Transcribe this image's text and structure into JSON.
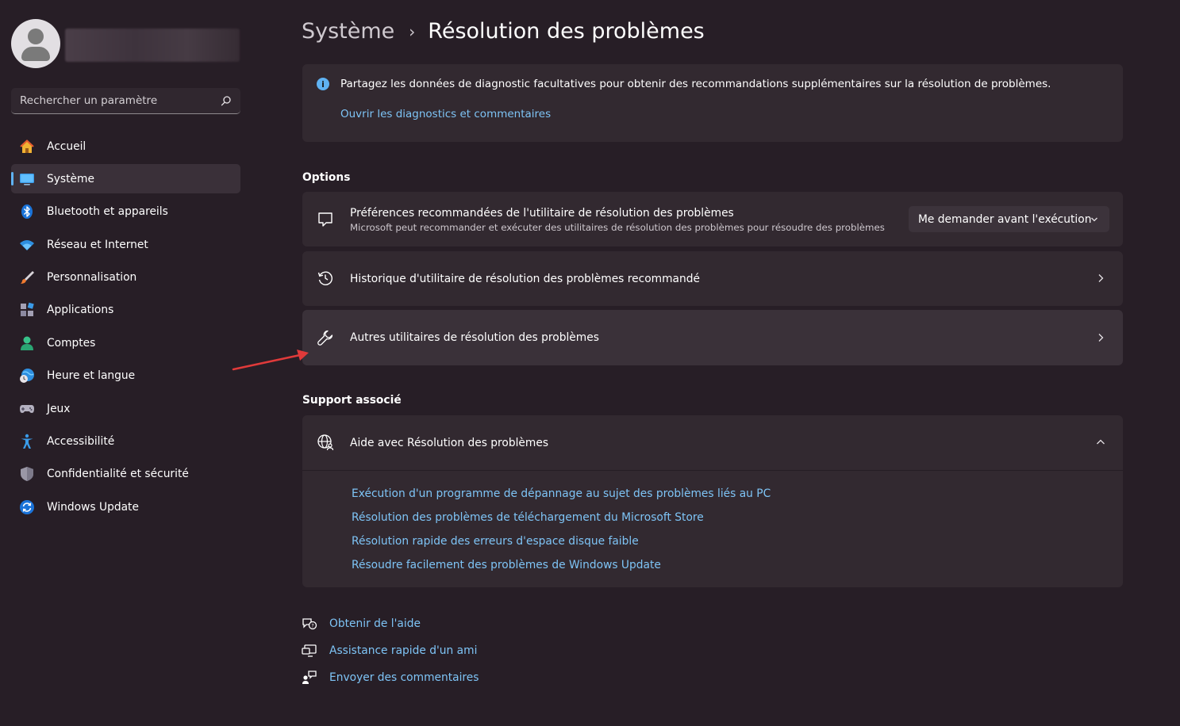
{
  "sidebar": {
    "search_placeholder": "Rechercher un paramètre",
    "items": [
      {
        "label": "Accueil",
        "icon": "home-icon"
      },
      {
        "label": "Système",
        "icon": "monitor-icon",
        "active": true
      },
      {
        "label": "Bluetooth et appareils",
        "icon": "bluetooth-icon"
      },
      {
        "label": "Réseau et Internet",
        "icon": "wifi-icon"
      },
      {
        "label": "Personnalisation",
        "icon": "brush-icon"
      },
      {
        "label": "Applications",
        "icon": "apps-icon"
      },
      {
        "label": "Comptes",
        "icon": "person-icon"
      },
      {
        "label": "Heure et langue",
        "icon": "globe-clock-icon"
      },
      {
        "label": "Jeux",
        "icon": "gamepad-icon"
      },
      {
        "label": "Accessibilité",
        "icon": "accessibility-icon"
      },
      {
        "label": "Confidentialité et sécurité",
        "icon": "shield-icon"
      },
      {
        "label": "Windows Update",
        "icon": "update-icon"
      }
    ]
  },
  "header": {
    "parent": "Système",
    "separator": "›",
    "current": "Résolution des problèmes"
  },
  "info": {
    "text": "Partagez les données de diagnostic facultatives pour obtenir des recommandations supplémentaires sur la résolution de problèmes.",
    "link": "Ouvrir les diagnostics et commentaires"
  },
  "options": {
    "title": "Options",
    "preferences": {
      "title": "Préférences recommandées de l'utilitaire de résolution des problèmes",
      "subtitle": "Microsoft peut recommander et exécuter des utilitaires de résolution des problèmes pour résoudre des problèmes",
      "dropdown_value": "Me demander avant l'exécution"
    },
    "history": {
      "title": "Historique d'utilitaire de résolution des problèmes recommandé"
    },
    "other": {
      "title": "Autres utilitaires de résolution des problèmes"
    }
  },
  "support": {
    "title": "Support associé",
    "card_title": "Aide avec Résolution des problèmes",
    "links": [
      "Exécution d'un programme de dépannage au sujet des problèmes liés au PC",
      "Résolution des problèmes de téléchargement du Microsoft Store",
      "Résolution rapide des erreurs d'espace disque faible",
      "Résoudre facilement des problèmes de Windows Update"
    ]
  },
  "bottom_links": [
    {
      "label": "Obtenir de l'aide",
      "icon": "help-chat-icon"
    },
    {
      "label": "Assistance rapide d'un ami",
      "icon": "remote-assist-icon"
    },
    {
      "label": "Envoyer des commentaires",
      "icon": "feedback-icon"
    }
  ],
  "colors": {
    "background": "#271e26",
    "card": "#322930",
    "accent": "#5fb2f2",
    "link": "#7ec4f6",
    "annotation_arrow": "#e03a3a"
  }
}
